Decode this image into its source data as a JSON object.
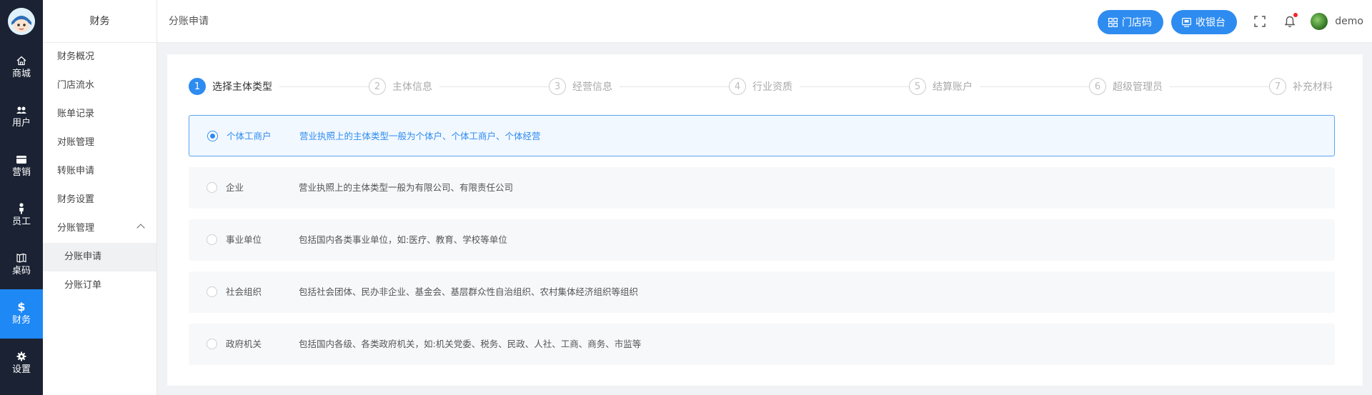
{
  "rail": {
    "items": [
      {
        "label": "商城",
        "icon": "home-icon"
      },
      {
        "label": "用户",
        "icon": "users-icon"
      },
      {
        "label": "营销",
        "icon": "marketing-icon"
      },
      {
        "label": "员工",
        "icon": "staff-icon"
      },
      {
        "label": "桌码",
        "icon": "table-code-icon"
      },
      {
        "label": "财务",
        "icon": "dollar-icon"
      },
      {
        "label": "设置",
        "icon": "gear-icon"
      }
    ],
    "active_index": 5
  },
  "sidebar": {
    "title": "财务",
    "items": [
      {
        "label": "财务概况"
      },
      {
        "label": "门店流水"
      },
      {
        "label": "账单记录"
      },
      {
        "label": "对账管理"
      },
      {
        "label": "转账申请"
      },
      {
        "label": "财务设置"
      },
      {
        "label": "分账管理"
      },
      {
        "label": "分账申请"
      },
      {
        "label": "分账订单"
      }
    ]
  },
  "header": {
    "breadcrumb": "分账申请",
    "store_code_label": "门店码",
    "cashier_label": "收银台",
    "username": "demo"
  },
  "steps": [
    {
      "num": "1",
      "label": "选择主体类型"
    },
    {
      "num": "2",
      "label": "主体信息"
    },
    {
      "num": "3",
      "label": "经营信息"
    },
    {
      "num": "4",
      "label": "行业资质"
    },
    {
      "num": "5",
      "label": "结算账户"
    },
    {
      "num": "6",
      "label": "超级管理员"
    },
    {
      "num": "7",
      "label": "补充材料"
    }
  ],
  "current_step": 1,
  "options": [
    {
      "name": "个体工商户",
      "desc": "营业执照上的主体类型一般为个体户、个体工商户、个体经营"
    },
    {
      "name": "企业",
      "desc": "营业执照上的主体类型一般为有限公司、有限责任公司"
    },
    {
      "name": "事业单位",
      "desc": "包括国内各类事业单位，如:医疗、教育、学校等单位"
    },
    {
      "name": "社会组织",
      "desc": "包括社会团体、民办非企业、基金会、基层群众性自治组织、农村集体经济组织等组织"
    },
    {
      "name": "政府机关",
      "desc": "包括国内各级、各类政府机关，如:机关党委、税务、民政、人社、工商、商务、市监等"
    }
  ],
  "selected_option": "个体工商户",
  "colors": {
    "accent": "#2e8cf0",
    "rail_bg": "#1a2233",
    "notification": "#f5222d"
  }
}
